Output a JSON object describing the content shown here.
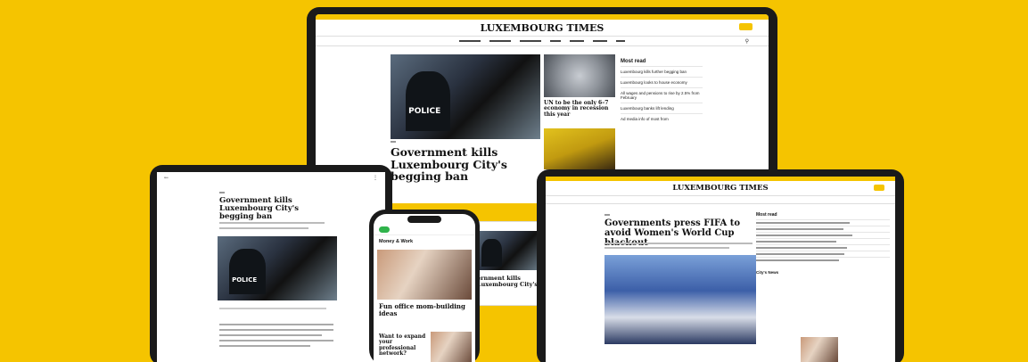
{
  "brand": {
    "name": "LUXEMBOURG TIMES",
    "accent": "#f5c400",
    "background": "#f5c400"
  },
  "main_screen": {
    "nav": [
      "",
      "",
      "",
      "",
      "",
      "",
      "",
      ""
    ],
    "headline": "Government kills Luxembourg City's begging ban",
    "side_story_1": "UN to be the only 6–7 economy in recession this year",
    "most_read_title": "Most read",
    "most_read": [
      "Luxembourg kills further begging ban",
      "Luxembourg looks to house economy",
      "All wages and pensions to rise by 2.5% from February",
      "Luxembourg banks lift lending",
      "Ad media info of most from"
    ],
    "police_tag": "POLICE"
  },
  "left_tablet": {
    "headline": "Government kills Luxembourg City's begging ban",
    "police_tag": "POLICE"
  },
  "phone": {
    "section": "Money & Work",
    "headline_1": "Fun office mom-building ideas",
    "headline_2": "Want to expand your professional network?"
  },
  "mid_sliver": {
    "headline": "ernment kills Luxembourg City's"
  },
  "right_tablet": {
    "headline": "Governments press FIFA to avoid Women's World Cup blackout",
    "most_read_title": "Most read",
    "most_read": [
      "",
      "",
      "",
      "",
      "",
      "",
      ""
    ],
    "city_news_title": "City's News"
  },
  "icons": {
    "search": "search-icon",
    "menu": "menu-icon"
  }
}
